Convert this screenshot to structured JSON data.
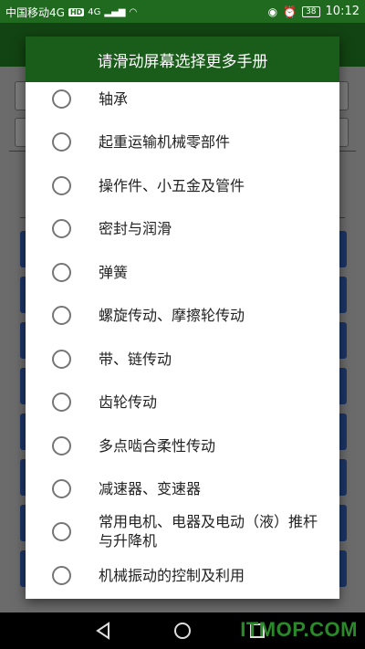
{
  "status_bar": {
    "carrier": "中国移动4G",
    "hd": "HD",
    "network": "4G",
    "battery": "38",
    "time": "10:12"
  },
  "dialog": {
    "title": "请滑动屏幕选择更多手册",
    "items": [
      {
        "label": "轴承"
      },
      {
        "label": "起重运输机械零部件"
      },
      {
        "label": "操作件、小五金及管件"
      },
      {
        "label": "密封与润滑"
      },
      {
        "label": "弹簧"
      },
      {
        "label": "螺旋传动、摩擦轮传动"
      },
      {
        "label": "带、链传动"
      },
      {
        "label": "齿轮传动"
      },
      {
        "label": "多点啮合柔性传动"
      },
      {
        "label": "减速器、变速器"
      },
      {
        "label": "常用电机、电器及电动（液）推杆与升降机"
      },
      {
        "label": "机械振动的控制及利用"
      }
    ]
  },
  "watermark": "ITMOP.COM"
}
